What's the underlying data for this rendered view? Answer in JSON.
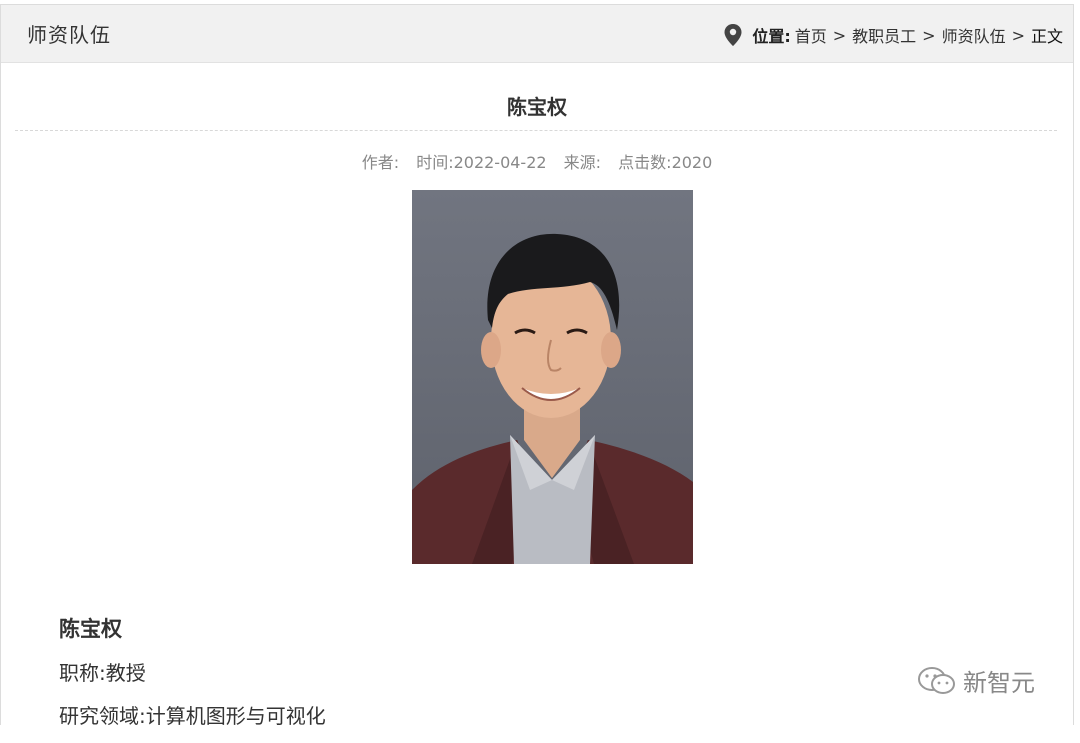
{
  "header": {
    "section_title": "师资队伍",
    "location_label": "位置:",
    "breadcrumb": [
      "首页",
      "教职员工",
      "师资队伍"
    ],
    "breadcrumb_current": "正文",
    "separator": ">"
  },
  "article": {
    "title": "陈宝权",
    "meta": {
      "author": "作者:",
      "time": "时间:2022-04-22",
      "source": "来源:",
      "clicks": "点击数:2020"
    }
  },
  "bio": {
    "name": "陈宝权",
    "title_line": "职称:教授",
    "research_line": "研究领域:计算机图形与可视化"
  },
  "watermark": {
    "text": "新智元",
    "icon": "wechat-icon"
  },
  "icons": {
    "location": "location-pin-icon"
  }
}
